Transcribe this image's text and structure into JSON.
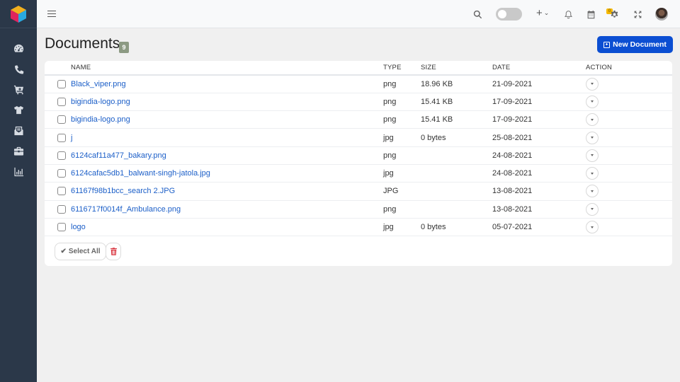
{
  "topbar": {
    "menu_icon": "hamburger-icon",
    "icons": [
      "search-icon",
      "theme-toggle",
      "plus-icon",
      "bell-icon",
      "calendar-icon",
      "gear-icon",
      "fullscreen-icon",
      "avatar"
    ],
    "plus_label": "+",
    "notification_count": "0",
    "toggle_on": false
  },
  "sidebar": {
    "items": [
      {
        "icon": "dashboard-gauge-icon"
      },
      {
        "icon": "phone-icon"
      },
      {
        "icon": "cart-icon"
      },
      {
        "icon": "tshirt-icon"
      },
      {
        "icon": "envelope-open-icon"
      },
      {
        "icon": "briefcase-icon"
      },
      {
        "icon": "bar-chart-icon"
      }
    ]
  },
  "page": {
    "title": "Documents",
    "count": "9",
    "new_button": "New Document"
  },
  "colors": {
    "sidebar_bg": "#2b3849",
    "primary": "#0b4ed2",
    "link": "#1c5fc8",
    "badge": "#8c9a83",
    "danger": "#d8303b",
    "notification": "#f5b800"
  },
  "table": {
    "headers": {
      "name": "NAME",
      "type": "TYPE",
      "size": "SIZE",
      "date": "DATE",
      "action": "ACTION"
    },
    "rows": [
      {
        "name": "Black_viper.png",
        "type": "png",
        "size": "18.96 KB",
        "date": "21-09-2021"
      },
      {
        "name": "bigindia-logo.png",
        "type": "png",
        "size": "15.41 KB",
        "date": "17-09-2021"
      },
      {
        "name": "bigindia-logo.png",
        "type": "png",
        "size": "15.41 KB",
        "date": "17-09-2021"
      },
      {
        "name": "j",
        "type": "jpg",
        "size": "0 bytes",
        "date": "25-08-2021"
      },
      {
        "name": "6124caf11a477_bakary.png",
        "type": "png",
        "size": "",
        "date": "24-08-2021"
      },
      {
        "name": "6124cafac5db1_balwant-singh-jatola.jpg",
        "type": "jpg",
        "size": "",
        "date": "24-08-2021"
      },
      {
        "name": "61167f98b1bcc_search 2.JPG",
        "type": "JPG",
        "size": "",
        "date": "13-08-2021"
      },
      {
        "name": "6116717f0014f_Ambulance.png",
        "type": "png",
        "size": "",
        "date": "13-08-2021"
      },
      {
        "name": "logo",
        "type": "jpg",
        "size": "0 bytes",
        "date": "05-07-2021"
      }
    ]
  },
  "footer": {
    "select_all": "Select All",
    "delete_icon": "trash-icon"
  }
}
